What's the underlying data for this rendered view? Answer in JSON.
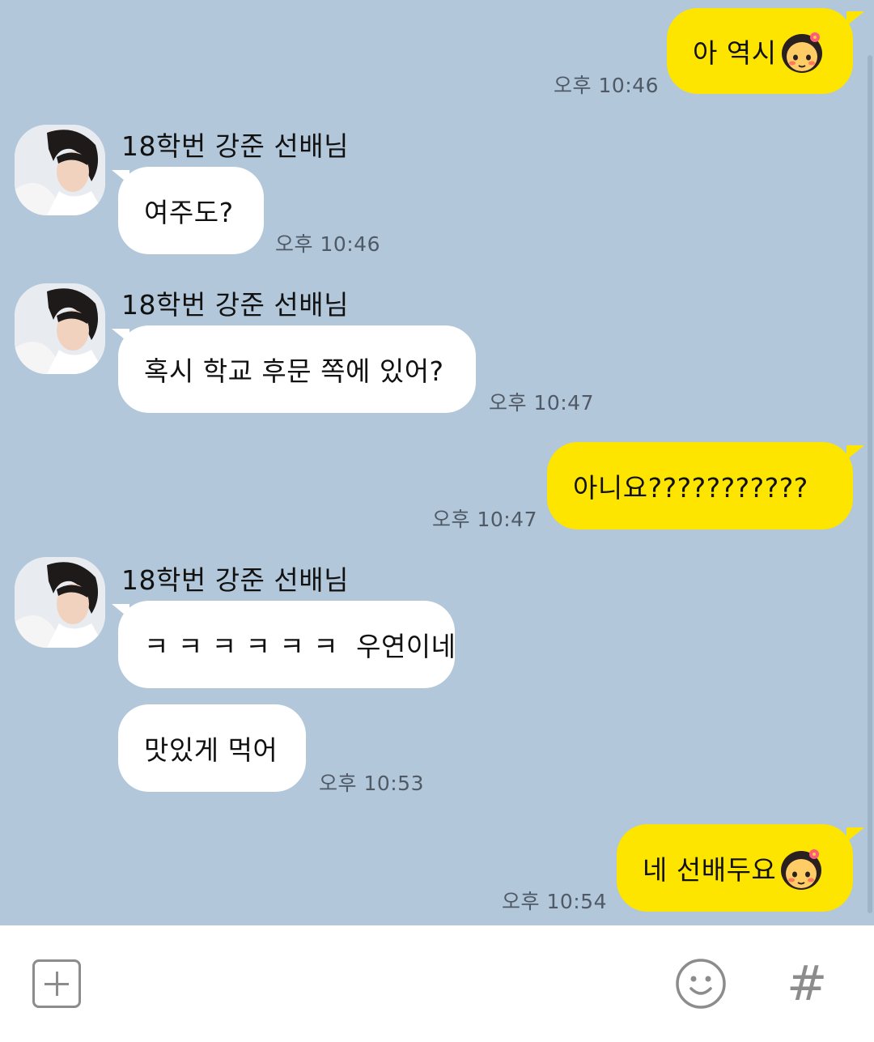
{
  "chat": {
    "messages": [
      {
        "type": "outgoing",
        "text": "아 역시",
        "emoji": "blushing-girl-emoticon",
        "time": "오후 10:46"
      },
      {
        "type": "incoming",
        "sender": "18학번 강준 선배님",
        "text": "여주도?",
        "time": "오후 10:46"
      },
      {
        "type": "incoming",
        "sender": "18학번 강준 선배님",
        "text": "혹시 학교 후문 쪽에 있어?",
        "time": "오후 10:47"
      },
      {
        "type": "outgoing",
        "text": "아니요???????????",
        "time": "오후 10:47"
      },
      {
        "type": "incoming",
        "sender": "18학번 강준 선배님",
        "text": "ㅋ ㅋ ㅋ ㅋ ㅋ ㅋ  우연이네",
        "time": ""
      },
      {
        "type": "incoming",
        "text": "맛있게 먹어",
        "time": "오후 10:53"
      },
      {
        "type": "outgoing",
        "text": "네 선배두요",
        "emoji": "blushing-girl-emoticon",
        "time": "오후 10:54"
      }
    ]
  },
  "input_bar": {
    "icons": [
      "plus-icon",
      "smiley-icon",
      "hash-icon"
    ],
    "hash_glyph": "#"
  },
  "colors": {
    "chat_background": "#b2c7da",
    "outgoing_bubble": "#fee500",
    "incoming_bubble": "#ffffff"
  }
}
